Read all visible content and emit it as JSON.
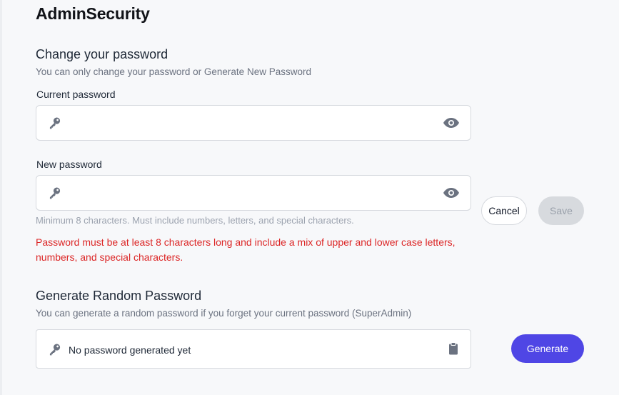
{
  "page": {
    "title": "AdminSecurity"
  },
  "change_password": {
    "title": "Change your password",
    "subtitle": "You can only change your password or Generate New Password",
    "current": {
      "label": "Current password",
      "value": "",
      "placeholder": ""
    },
    "new": {
      "label": "New password",
      "value": "",
      "placeholder": ""
    },
    "hint": "Minimum 8 characters. Must include numbers, letters, and special characters.",
    "error": "Password must be at least 8 characters long and include a mix of upper and lower case letters, numbers, and special characters.",
    "cancel_label": "Cancel",
    "save_label": "Save"
  },
  "generate": {
    "title": "Generate Random Password",
    "subtitle": "You can generate a random password if you forget your current password (SuperAdmin)",
    "status_text": "No password generated yet",
    "button_label": "Generate"
  },
  "icons": {
    "key": "key-icon",
    "eye": "eye-icon",
    "clipboard": "clipboard-icon"
  },
  "colors": {
    "accent": "#4f46e5",
    "error": "#dc2626",
    "icon": "#6b7280",
    "save_disabled_bg": "#d7dade"
  }
}
